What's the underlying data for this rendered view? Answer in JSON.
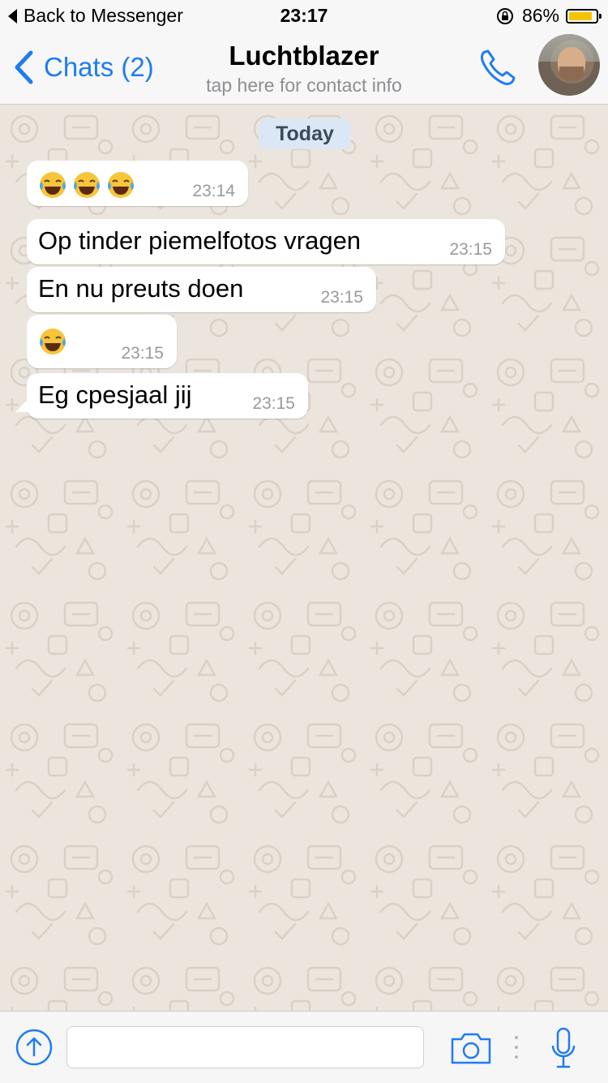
{
  "status_bar": {
    "back_label": "Back to Messenger",
    "time": "23:17",
    "battery": "86%",
    "battery_level": 0.86,
    "battery_color": "#f5c400"
  },
  "nav": {
    "back_label": "Chats (2)",
    "title": "Luchtblazer",
    "subtitle": "tap here for contact info",
    "accent_color": "#1e7cf2",
    "call_icon": "phone-icon",
    "avatar": "contact-avatar"
  },
  "chat": {
    "date_label": "Today",
    "messages": [
      {
        "text": "",
        "emoji_count": 3,
        "emoji": "face-with-tears-of-joy",
        "time": "23:14"
      },
      {
        "text": "Op tinder piemelfotos vragen",
        "emoji_count": 0,
        "time": "23:15"
      },
      {
        "text": "En nu preuts doen",
        "emoji_count": 0,
        "time": "23:15"
      },
      {
        "text": "",
        "emoji_count": 1,
        "emoji": "face-with-tears-of-joy",
        "time": "23:15"
      },
      {
        "text": "Eg cpesjaal jij",
        "emoji_count": 0,
        "time": "23:15"
      }
    ]
  },
  "input_bar": {
    "attach_icon": "upload-icon",
    "message_value": "",
    "message_placeholder": "",
    "camera_icon": "camera-icon",
    "mic_icon": "microphone-icon"
  }
}
